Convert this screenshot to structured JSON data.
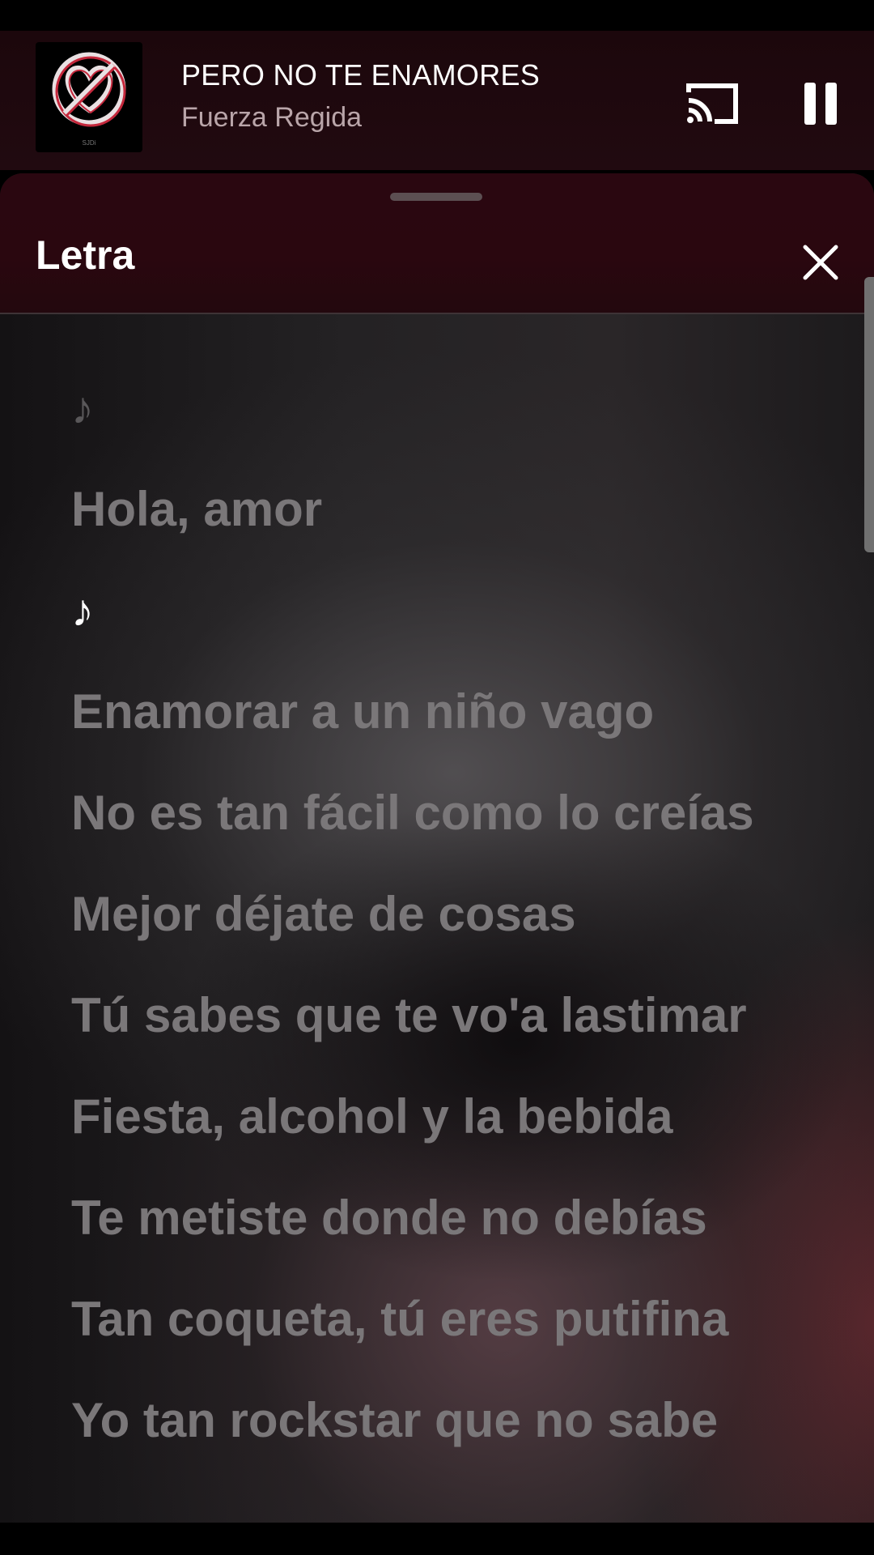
{
  "mini_player": {
    "track_title": "PERO NO TE ENAMORES",
    "artist": "Fuerza Regida",
    "album_art_icon": "crossed-heart-icon",
    "album_art_text": "SJDi",
    "cast_icon": "cast-icon",
    "pause_icon": "pause-icon"
  },
  "lyrics_sheet": {
    "title": "Letra",
    "close_icon": "close-icon",
    "lines": [
      {
        "text": "♪",
        "state": "dim"
      },
      {
        "text": "Hola, amor",
        "state": "past"
      },
      {
        "text": "♪",
        "state": "active"
      },
      {
        "text": "Enamorar a un niño vago",
        "state": "upcoming"
      },
      {
        "text": "No es tan fácil como lo creías",
        "state": "upcoming"
      },
      {
        "text": "Mejor déjate de cosas",
        "state": "upcoming"
      },
      {
        "text": "Tú sabes que te vo'a lastimar",
        "state": "upcoming"
      },
      {
        "text": "Fiesta, alcohol y la bebida",
        "state": "upcoming"
      },
      {
        "text": "Te metiste donde no debías",
        "state": "upcoming"
      },
      {
        "text": "Tan coqueta, tú eres putifina",
        "state": "upcoming"
      },
      {
        "text": "Yo tan rockstar que no sabe",
        "state": "upcoming"
      }
    ]
  },
  "colors": {
    "mini_player_bg": "#1f090e",
    "sheet_header_bg": "#2a070f",
    "active_lyric": "#ffffff",
    "inactive_lyric": "#7a7779"
  }
}
